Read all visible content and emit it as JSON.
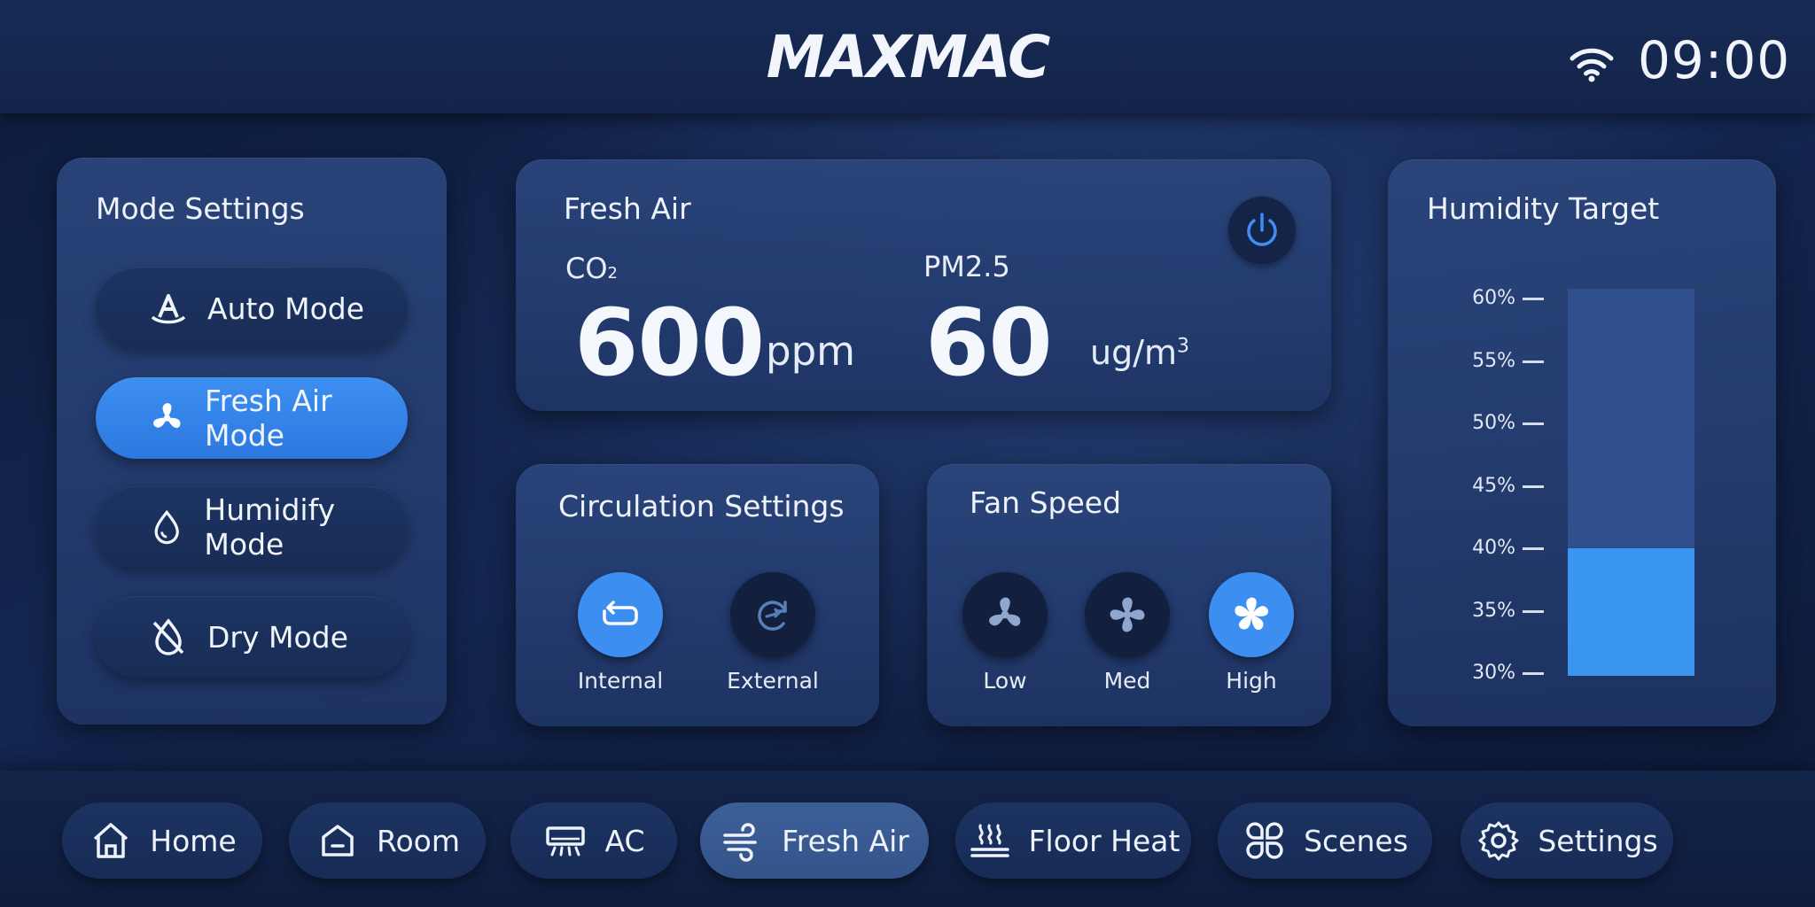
{
  "header": {
    "logo": "MAXMAC",
    "time": "09:00",
    "wifi_icon": "wifi-icon"
  },
  "mode_settings": {
    "title": "Mode Settings",
    "active": "Fresh Air Mode",
    "items": [
      {
        "label": "Auto Mode",
        "icon": "auto-mode-icon"
      },
      {
        "label": "Fresh Air Mode",
        "icon": "fan-icon"
      },
      {
        "label": "Humidify Mode",
        "icon": "water-drop-icon"
      },
      {
        "label": "Dry Mode",
        "icon": "no-drop-icon"
      }
    ]
  },
  "fresh_air": {
    "title": "Fresh Air",
    "co2": {
      "label": "CO",
      "sub": "2",
      "value": "600",
      "unit": "ppm"
    },
    "pm25": {
      "label": "PM2.5",
      "value": "60",
      "unit": "ug/m",
      "unit_sup": "3"
    },
    "power_icon": "power-icon"
  },
  "circulation": {
    "title": "Circulation Settings",
    "active": "Internal",
    "options": [
      {
        "label": "Internal",
        "icon": "internal-circulation-icon"
      },
      {
        "label": "External",
        "icon": "external-circulation-icon"
      }
    ]
  },
  "fan_speed": {
    "title": "Fan Speed",
    "active": "High",
    "options": [
      {
        "label": "Low",
        "icon": "fan-icon"
      },
      {
        "label": "Med",
        "icon": "fan-icon"
      },
      {
        "label": "High",
        "icon": "fan-icon"
      }
    ]
  },
  "humidity": {
    "title": "Humidity Target",
    "ticks": [
      "60%",
      "55%",
      "50%",
      "45%",
      "40%",
      "35%",
      "30%"
    ],
    "min": 30,
    "max": 60,
    "target": 40,
    "fill_color": "#3b96f2"
  },
  "nav": {
    "active": "Fresh Air",
    "items": [
      {
        "label": "Home",
        "icon": "home-icon"
      },
      {
        "label": "Room",
        "icon": "room-icon"
      },
      {
        "label": "AC",
        "icon": "ac-icon"
      },
      {
        "label": "Fresh Air",
        "icon": "wind-icon"
      },
      {
        "label": "Floor Heat",
        "icon": "floor-heat-icon"
      },
      {
        "label": "Scenes",
        "icon": "scenes-icon"
      },
      {
        "label": "Settings",
        "icon": "gear-icon"
      }
    ]
  },
  "colors": {
    "accent": "#3c8ff0",
    "background": "#132650",
    "panel": "#2b467d"
  }
}
